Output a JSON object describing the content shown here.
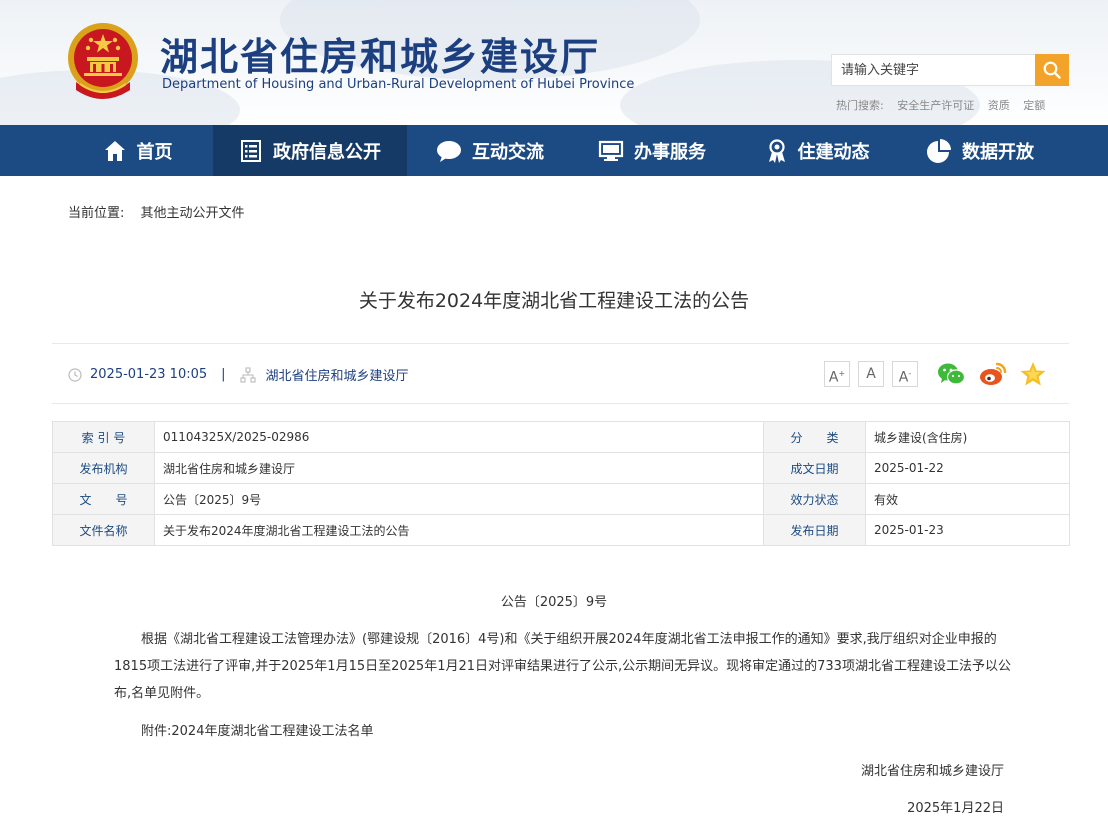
{
  "header": {
    "title": "湖北省住房和城乡建设厅",
    "subtitle": "Department of Housing and Urban-Rural Development of Hubei Province",
    "search_placeholder": "请输入关键字",
    "hot_label": "热门搜索:",
    "hot_items": [
      "安全生产许可证",
      "资质",
      "定额"
    ]
  },
  "nav": {
    "items": [
      {
        "label": "首页",
        "icon": "home-icon"
      },
      {
        "label": "政府信息公开",
        "icon": "document-list-icon",
        "active": true
      },
      {
        "label": "互动交流",
        "icon": "chat-bubble-icon"
      },
      {
        "label": "办事服务",
        "icon": "monitor-icon"
      },
      {
        "label": "住建动态",
        "icon": "award-icon"
      },
      {
        "label": "数据开放",
        "icon": "pie-chart-icon"
      }
    ]
  },
  "breadcrumb": {
    "label": "当前位置:",
    "item": "其他主动公开文件"
  },
  "article": {
    "title": "关于发布2024年度湖北省工程建设工法的公告",
    "datetime": "2025-01-23 10:05",
    "separator": "|",
    "source": "湖北省住房和城乡建设厅",
    "font_sizes": [
      "A+",
      "A",
      "A-"
    ],
    "share": [
      "wechat-icon",
      "weibo-icon",
      "favorite-star-icon"
    ]
  },
  "info_table": {
    "rows": [
      {
        "l1": "索 引 号",
        "v1": "01104325X/2025-02986",
        "l2": "分　　类",
        "v2": "城乡建设(含住房)"
      },
      {
        "l1": "发布机构",
        "v1": "湖北省住房和城乡建设厅",
        "l2": "成文日期",
        "v2": "2025-01-22"
      },
      {
        "l1": "文　　号",
        "v1": "公告〔2025〕9号",
        "l2": "效力状态",
        "v2": "有效"
      },
      {
        "l1": "文件名称",
        "v1": "关于发布2024年度湖北省工程建设工法的公告",
        "l2": "发布日期",
        "v2": "2025-01-23"
      }
    ]
  },
  "content": {
    "doc_number": "公告〔2025〕9号",
    "paragraph": "根据《湖北省工程建设工法管理办法》(鄂建设规〔2016〕4号)和《关于组织开展2024年度湖北省工法申报工作的通知》要求,我厅组织对企业申报的1815项工法进行了评审,并于2025年1月15日至2025年1月21日对评审结果进行了公示,公示期间无异议。现将审定通过的733项湖北省工程建设工法予以公布,名单见附件。",
    "attachment": "附件:2024年度湖北省工程建设工法名单",
    "signature": "湖北省住房和城乡建设厅",
    "sign_date": "2025年1月22日"
  },
  "colors": {
    "nav_bg": "#1c4b83",
    "nav_active": "#153a66",
    "title_blue": "#1c3f80",
    "search_button": "#f3a32a"
  }
}
